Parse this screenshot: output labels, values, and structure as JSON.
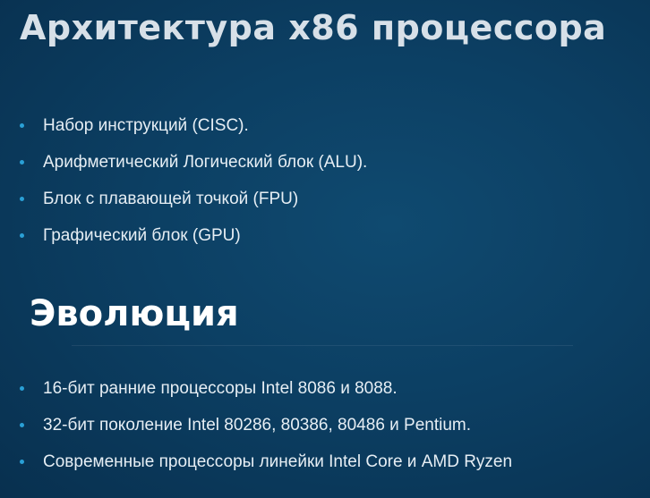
{
  "slide": {
    "title": "Архитектура x86 процессора",
    "architecture_items": [
      "Набор инструкций (CISC).",
      "Арифметический Логический блок (ALU).",
      "Блок с плавающей точкой (FPU)",
      "Графический блок (GPU)"
    ],
    "evolution_title": "Эволюция",
    "evolution_items": [
      "16-бит ранние процессоры Intel 8086 и 8088.",
      "32-бит поколение Intel 80286, 80386, 80486 и Pentium.",
      "Современные процессоры линейки Intel Core и AMD Ryzen"
    ],
    "colors": {
      "background": "#0c3f63",
      "bullet": "#2aa0d6",
      "title": "#d7e0e8",
      "text": "#e6eef4"
    }
  }
}
